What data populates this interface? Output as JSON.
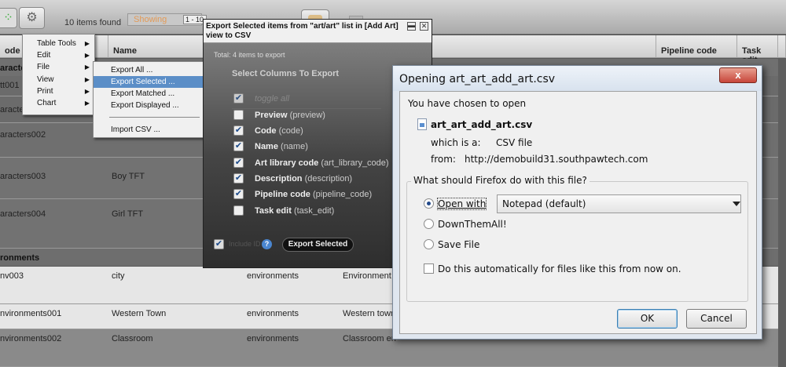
{
  "toolbar": {
    "items_found": "10 items found",
    "showing_label": "Showing",
    "page_value": "1 - 10"
  },
  "table": {
    "headers": [
      "ode",
      "Name",
      "Pipeline code",
      "Task edit"
    ],
    "groups": [
      "aracters",
      "ronments"
    ],
    "rows": [
      {
        "code": "tt001",
        "name": ""
      },
      {
        "code": "aracters",
        "name": ""
      },
      {
        "code": "aracters002",
        "name": ""
      },
      {
        "code": "aracters003",
        "name": "Boy TFT"
      },
      {
        "code": "aracters004",
        "name": "Girl TFT"
      },
      {
        "code": "nv003",
        "name": "city",
        "library": "environments",
        "desc": "Environment o"
      },
      {
        "code": "nvironments001",
        "name": "Western Town",
        "library": "environments",
        "desc": "Western town"
      },
      {
        "code": "nvironments002",
        "name": "Classroom",
        "library": "environments",
        "desc": "Classroom en"
      }
    ]
  },
  "context_menu": {
    "items": [
      "Table Tools",
      "Edit",
      "File",
      "View",
      "Print",
      "Chart"
    ]
  },
  "file_submenu": {
    "items": [
      "Export All ...",
      "Export Selected ...",
      "Export Matched ...",
      "Export Displayed ...",
      "Import CSV ..."
    ],
    "highlighted": "Export Selected ..."
  },
  "export_dialog": {
    "title": "Export Selected items from \"art/art\" list in [Add Art] view to CSV",
    "total": "Total: 4 items to export",
    "select_heading": "Select Columns To Export",
    "toggle_all": "toggle all",
    "columns": [
      {
        "label": "Preview",
        "key": "(preview)",
        "checked": false
      },
      {
        "label": "Code",
        "key": "(code)",
        "checked": true
      },
      {
        "label": "Name",
        "key": "(name)",
        "checked": true
      },
      {
        "label": "Art library code",
        "key": "(art_library_code)",
        "checked": true
      },
      {
        "label": "Description",
        "key": "(description)",
        "checked": true
      },
      {
        "label": "Pipeline code",
        "key": "(pipeline_code)",
        "checked": true
      },
      {
        "label": "Task edit",
        "key": "(task_edit)",
        "checked": false
      }
    ],
    "include_id": "Include ID",
    "export_button": "Export Selected"
  },
  "firefox_dialog": {
    "title": "Opening art_art_add_art.csv",
    "close_glyph": "x",
    "you_have_chosen": "You have chosen to open",
    "filename": "art_art_add_art.csv",
    "which_is_label": "which is a:",
    "which_is_value": "CSV file",
    "from_label": "from:",
    "from_value": "http://demobuild31.southpawtech.com",
    "question": "What should Firefox do with this file?",
    "open_with": "Open with",
    "open_with_app": "Notepad (default)",
    "downthemall": "DownThemAll!",
    "save_file": "Save File",
    "auto_checkbox": "Do this automatically for files like this from now on.",
    "ok": "OK",
    "cancel": "Cancel"
  }
}
